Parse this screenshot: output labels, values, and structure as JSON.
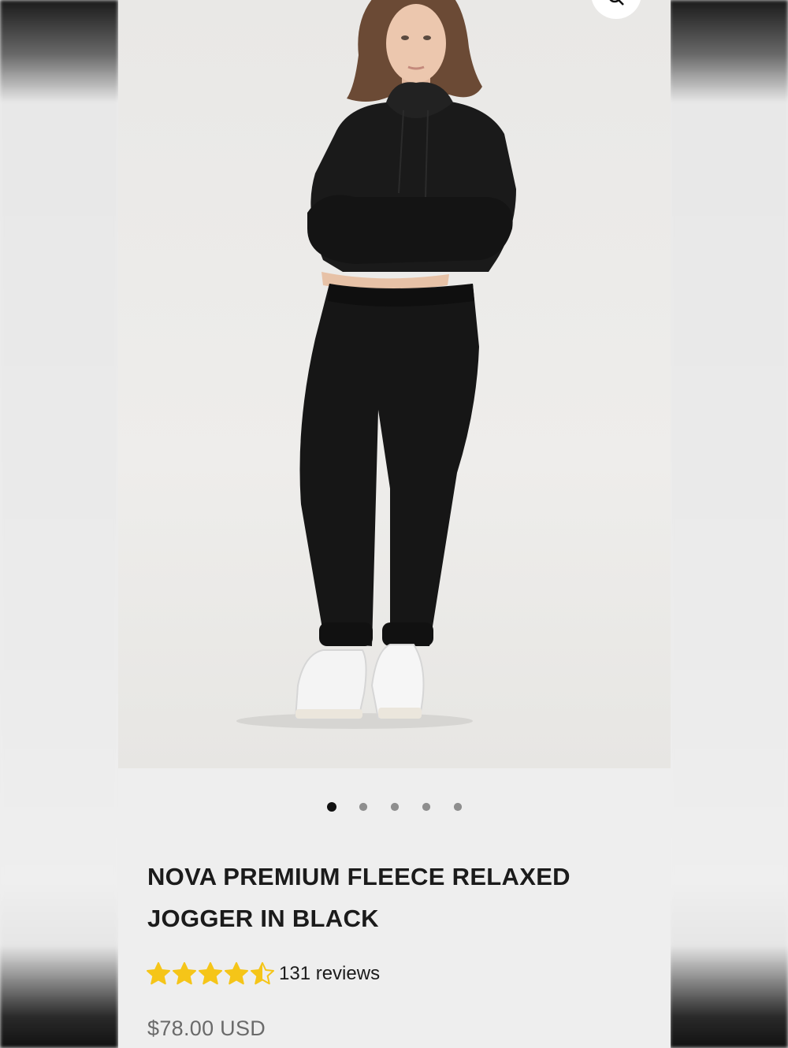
{
  "product": {
    "title": "NOVA PREMIUM FLEECE RELAXED JOGGER IN BLACK",
    "rating": 4.5,
    "rating_max": 5,
    "reviews_label": "131 reviews",
    "price": "$78.00 USD"
  },
  "gallery": {
    "image_count": 5,
    "active_index": 0
  },
  "colors": {
    "star": "#f5c518",
    "garment": "#161616",
    "dot_active": "#111111",
    "dot_inactive": "#8e8e8e"
  },
  "icons": {
    "zoom": "search-icon",
    "star": "star-icon"
  }
}
